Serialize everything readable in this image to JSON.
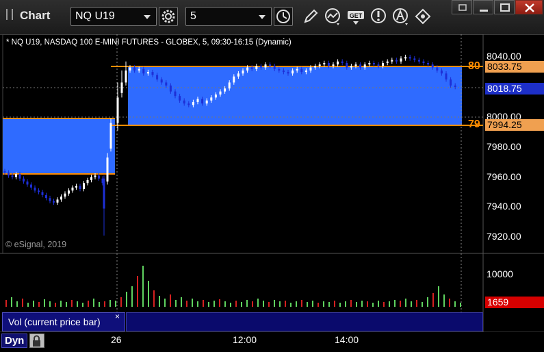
{
  "window": {
    "title": "Chart",
    "symbol": "NQ U19",
    "interval": "5"
  },
  "chart": {
    "header": "* NQ U19, NASDAQ 100 E-MINI FUTURES - GLOBEX, 5, 09:30-16:15 (Dynamic)",
    "copyright": "© eSignal, 2019",
    "price_axis_labels": [
      "8040.00",
      "8000.00",
      "7980.00",
      "7960.00",
      "7940.00",
      "7920.00"
    ],
    "price_tags": {
      "upper_level": "8033.75",
      "last_price": "8018.75",
      "lower_level": "7994.25"
    },
    "level_numbers": {
      "upper": "80",
      "lower": "79"
    },
    "colors": {
      "background": "#000000",
      "zone_fill": "#2f6bff",
      "level_line": "#ff8c00",
      "candle_up": "#ffffff",
      "candle_down": "#1d2fd6",
      "volume_up": "#5fd35f",
      "volume_down": "#d62020"
    }
  },
  "volume_panel": {
    "label": "Vol (current price bar)",
    "close_glyph": "×",
    "axis_label": "10000",
    "value_tag": "1659"
  },
  "time_axis": {
    "mode_button": "Dyn",
    "labels": [
      "26",
      "12:00",
      "14:00"
    ]
  },
  "icons": {
    "interval_clock": "clock-icon",
    "draw": "pencil-icon",
    "studies": "studies-icon",
    "get": "get-icon",
    "alert": "alert-icon",
    "link": "link-icon",
    "settings": "gear-icon"
  }
}
